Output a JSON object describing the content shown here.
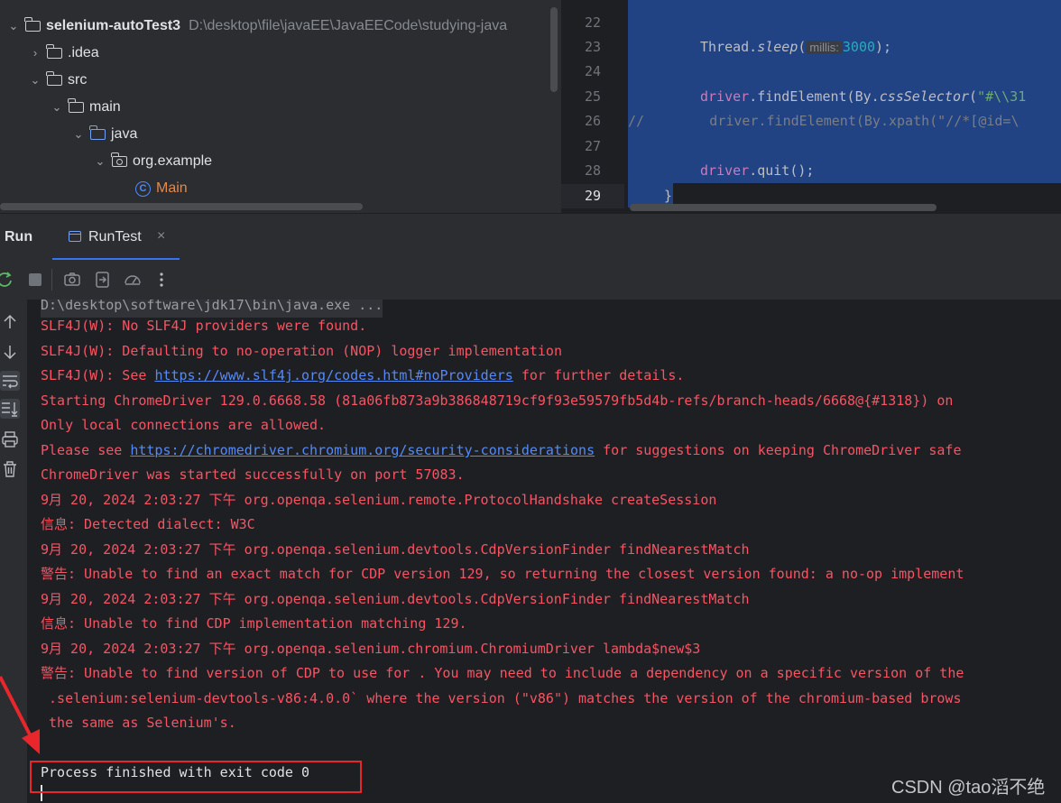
{
  "project_tree": {
    "items": [
      {
        "label": "selenium-autoTest3",
        "path": "D:\\desktop\\file\\javaEE\\JavaEECode\\studying-java"
      },
      {
        "label": ".idea"
      },
      {
        "label": "src"
      },
      {
        "label": "main"
      },
      {
        "label": "java"
      },
      {
        "label": "org.example"
      },
      {
        "label": "Main"
      }
    ]
  },
  "editor": {
    "line_numbers": [
      "22",
      "23",
      "24",
      "25",
      "26",
      "27",
      "28",
      "29"
    ],
    "lines": {
      "l23_a": "Thread.",
      "l23_b": "sleep",
      "l23_c": "(",
      "l23_hint": "millis:",
      "l23_num": "3000",
      "l23_d": ");",
      "l25_a": "driver",
      "l25_b": ".findElement(By.",
      "l25_c": "cssSelector",
      "l25_d": "(",
      "l25_e": "\"#\\\\31",
      "l26": "//        driver.findElement(By.xpath(\"//*[@id=\\",
      "l28_a": "driver",
      "l28_b": ".quit();",
      "l29": "}"
    }
  },
  "run_panel": {
    "title": "Run",
    "tab_label": "RunTest",
    "close_glyph": "×",
    "toolbar": [
      "rerun-icon",
      "stop-icon",
      "camera-icon",
      "exit-icon",
      "gauge-icon",
      "more-icon"
    ],
    "sidebar": [
      "up-arrow-icon",
      "down-arrow-icon",
      "soft-wrap-icon",
      "scroll-to-end-icon",
      "print-icon",
      "trash-icon"
    ]
  },
  "console": {
    "command": "D:\\desktop\\software\\jdk17\\bin\\java.exe ...",
    "lines": [
      "SLF4J(W): No SLF4J providers were found.",
      "SLF4J(W): Defaulting to no-operation (NOP) logger implementation",
      {
        "pre": "SLF4J(W): See ",
        "link": "https://www.slf4j.org/codes.html#noProviders",
        "post": " for further details."
      },
      "Starting ChromeDriver 129.0.6668.58 (81a06fb873a9b386848719cf9f93e59579fb5d4b-refs/branch-heads/6668@{#1318}) on",
      "Only local connections are allowed.",
      {
        "pre": "Please see ",
        "link": "https://chromedriver.chromium.org/security-considerations",
        "post": " for suggestions on keeping ChromeDriver safe"
      },
      "ChromeDriver was started successfully on port 57083.",
      "9月 20, 2024 2:03:27 下午 org.openqa.selenium.remote.ProtocolHandshake createSession",
      "信息: Detected dialect: W3C",
      "9月 20, 2024 2:03:27 下午 org.openqa.selenium.devtools.CdpVersionFinder findNearestMatch",
      "警告: Unable to find an exact match for CDP version 129, so returning the closest version found: a no-op implement",
      "9月 20, 2024 2:03:27 下午 org.openqa.selenium.devtools.CdpVersionFinder findNearestMatch",
      "信息: Unable to find CDP implementation matching 129.",
      "9月 20, 2024 2:03:27 下午 org.openqa.selenium.chromium.ChromiumDriver lambda$new$3",
      "警告: Unable to find version of CDP to use for . You may need to include a dependency on a specific version of the",
      " .selenium:selenium-devtools-v86:4.0.0` where the version (\"v86\") matches the version of the chromium-based brows",
      " the same as Selenium's."
    ],
    "exit_message": "Process finished with exit code 0"
  },
  "watermark": "CSDN @tao滔不绝",
  "colors": {
    "error_text": "#f75464",
    "link": "#548af7",
    "selection": "#214283",
    "annotation_red": "#e8262b",
    "accent": "#3574f0"
  }
}
